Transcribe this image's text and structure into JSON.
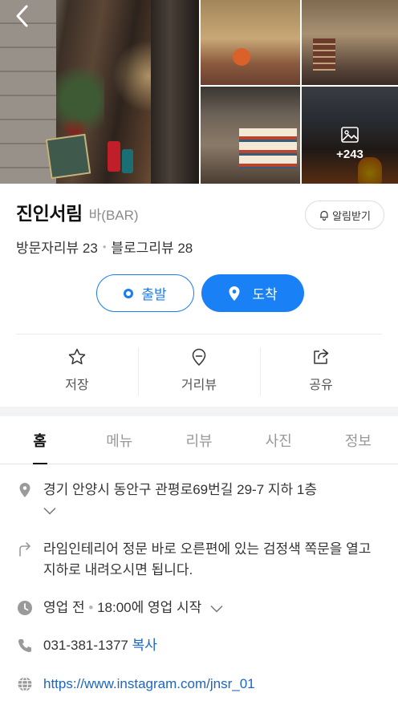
{
  "gallery": {
    "more_count": "+243"
  },
  "place": {
    "name": "진인서림",
    "category": "바(BAR)",
    "notify_label": "알림받기",
    "visitor_reviews": "방문자리뷰 23",
    "blog_reviews": "블로그리뷰 28"
  },
  "route": {
    "start_label": "출발",
    "arrive_label": "도착"
  },
  "actions": {
    "save": "저장",
    "street_view": "거리뷰",
    "share": "공유"
  },
  "tabs": [
    "홈",
    "메뉴",
    "리뷰",
    "사진",
    "정보"
  ],
  "info": {
    "address": "경기 안양시 동안구 관평로69번길 29-7 지하 1층",
    "directions": "라임인테리어 정문 바로 오른편에 있는 검정색 쪽문을 열고 지하로 내려오시면 됩니다.",
    "hours_status": "영업 전",
    "hours_detail": "18:00에 영업 시작",
    "phone": "031-381-1377",
    "copy_label": "복사",
    "website": "https://www.instagram.com/jnsr_01"
  },
  "colors": {
    "accent": "#1a80f5",
    "link": "#1a66c4"
  }
}
